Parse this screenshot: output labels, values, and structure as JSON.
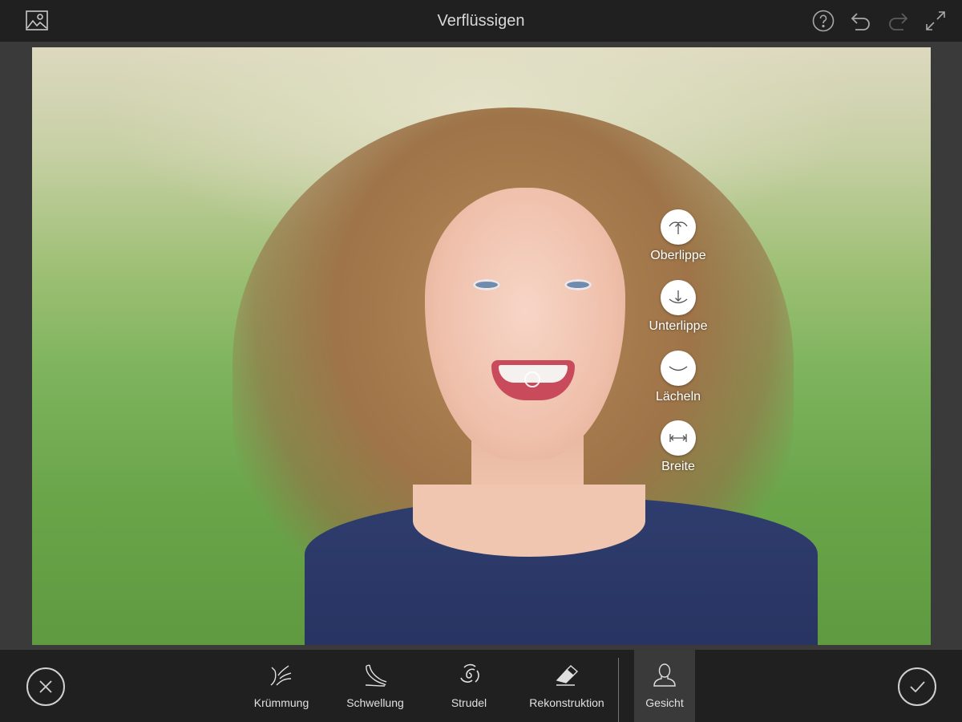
{
  "header": {
    "title": "Verflüssigen",
    "icons": [
      "image-library-icon",
      "help-icon",
      "undo-icon",
      "redo-icon",
      "fullscreen-icon"
    ]
  },
  "face_controls": [
    {
      "label": "Oberlippe",
      "icon": "upper-lip-icon"
    },
    {
      "label": "Unterlippe",
      "icon": "lower-lip-icon"
    },
    {
      "label": "Lächeln",
      "icon": "smile-icon"
    },
    {
      "label": "Breite",
      "icon": "width-icon"
    }
  ],
  "tools": [
    {
      "label": "Krümmung",
      "icon": "warp-icon"
    },
    {
      "label": "Schwellung",
      "icon": "bloat-icon"
    },
    {
      "label": "Strudel",
      "icon": "twirl-icon"
    },
    {
      "label": "Rekonstruktion",
      "icon": "eraser-icon"
    },
    {
      "label": "Gesicht",
      "icon": "face-icon",
      "active": true
    }
  ],
  "actions": {
    "cancel_icon": "close-icon",
    "confirm_icon": "checkmark-icon"
  },
  "colors": {
    "bar_background": "#202020",
    "workspace_background": "#3a3a3a",
    "active_tool_background": "#3a3a3a",
    "icon_color": "#d0d0d0"
  }
}
